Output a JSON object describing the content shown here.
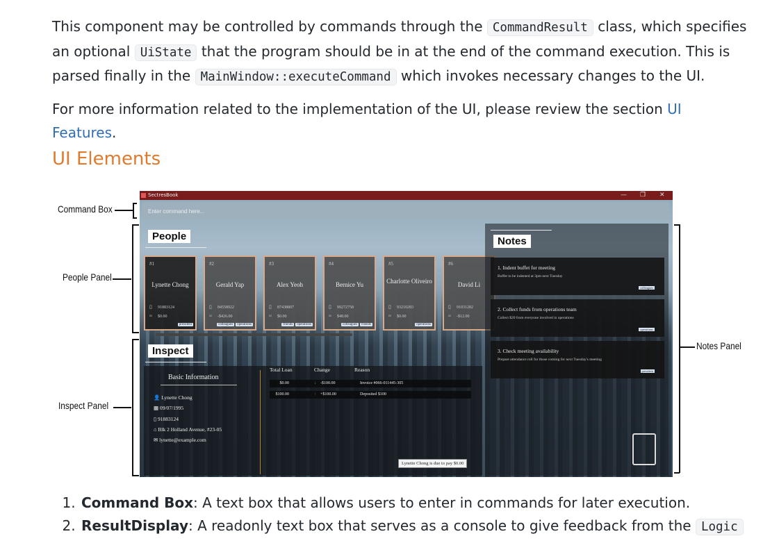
{
  "intro": {
    "p1_before": "This component may be controlled by commands through the ",
    "p1_code1": "CommandResult",
    "p1_mid1": " class, which specifies an optional ",
    "p1_code2": "UiState",
    "p1_mid2": " that the program should be in at the end of the command execution. This is parsed finally in the ",
    "p1_code3": "MainWindow::executeCommand",
    "p1_after": " which invokes necessary changes to the UI.",
    "p2_before": "For more information related to the implementation of the UI, please review the section ",
    "p2_link": "UI Features",
    "p2_after": "."
  },
  "section_title": "UI Elements",
  "figure": {
    "labels": {
      "command_box": "Command Box",
      "people_panel": "People Panel",
      "inspect_panel": "Inspect Panel",
      "notes_panel": "Notes Panel"
    },
    "app": {
      "title": "SectresBook",
      "command_placeholder": "Enter command here...",
      "people_title": "People",
      "inspect_title": "Inspect",
      "notes_title": "Notes",
      "people": [
        {
          "index": "#1",
          "name": "Lynette Chong",
          "phone": "91883124",
          "amount": "$0.00",
          "tags": [
            "president"
          ]
        },
        {
          "index": "#2",
          "name": "Gerald Yap",
          "phone": "84558922",
          "amount": "-$426.00",
          "tags": [
            "colleagues",
            "operations"
          ]
        },
        {
          "index": "#3",
          "name": "Alex Yeoh",
          "phone": "87438807",
          "amount": "$0.00",
          "tags": [
            "friends",
            "operations"
          ]
        },
        {
          "index": "#4",
          "name": "Bernice Yu",
          "phone": "99272758",
          "amount": "$48.00",
          "tags": [
            "colleagues",
            "friends"
          ]
        },
        {
          "index": "#5",
          "name": "Charlotte Oliveiro",
          "phone": "93210283",
          "amount": "$0.00",
          "tags": [
            "operations"
          ]
        },
        {
          "index": "#6",
          "name": "David Li",
          "phone": "91031282",
          "amount": "-$12.00",
          "tags": []
        }
      ],
      "inspect": {
        "basic_info_title": "Basic Information",
        "name": "Lynette Chong",
        "birthday": "09/07/1995",
        "phone": "91883124",
        "address": "Blk 2 Holland Avenue, #23-05",
        "email": "lynette@example.com",
        "headers": {
          "total_loan": "Total Loan",
          "change": "Change",
          "reason": "Reason"
        },
        "rows": [
          {
            "total": "$0.00",
            "change": "-$100.00",
            "reason": "Invoice #066-011445-305",
            "direction": "down"
          },
          {
            "total": "$100.00",
            "change": "+$100.00",
            "reason": "Deposited $100",
            "direction": "up"
          }
        ],
        "due_message": "Lynette Chong is due to pay $0.00"
      },
      "notes": [
        {
          "title": "1.  Indent buffet for meeting",
          "body": "Buffet to be indented at 3pm next Tuesday",
          "tag": "colleagues"
        },
        {
          "title": "2.  Collect funds from operations team",
          "body": "Collect $20 from everyone involved in operations",
          "tag": "operations"
        },
        {
          "title": "3.  Check meeting availability",
          "body": "Prepare attendance roll for those coming for next Tuesday's meeting",
          "tag": "president"
        }
      ]
    }
  },
  "list": [
    {
      "term": "Command Box",
      "desc": ": A text box that allows users to enter in commands for later execution."
    },
    {
      "term": "ResultDisplay",
      "desc": ": A readonly text box that serves as a console to give feedback from the ",
      "code": "Logic"
    }
  ]
}
